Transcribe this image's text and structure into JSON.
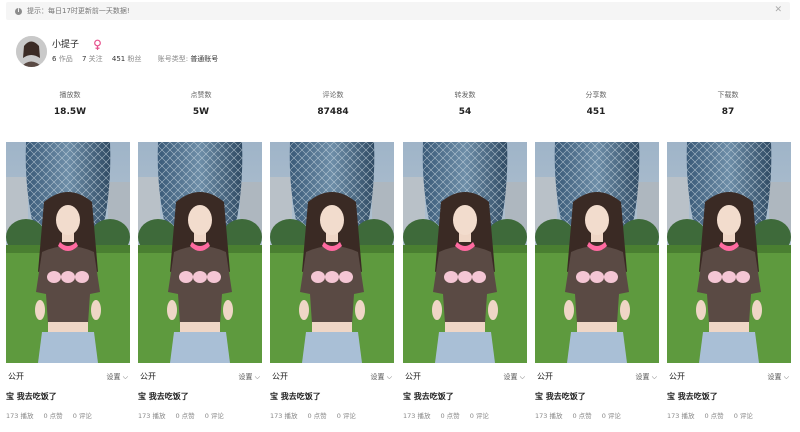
{
  "notice": {
    "text": "提示：每日17时更新前一天数据!"
  },
  "profile": {
    "name": "小提子",
    "works_count": "6",
    "works_label": "作品",
    "following_count": "7",
    "following_label": "关注",
    "followers_count": "451",
    "followers_label": "粉丝",
    "account_type_label": "账号类型:",
    "account_type_value": "普通账号"
  },
  "metrics": [
    {
      "label": "播放数",
      "value": "18.5W"
    },
    {
      "label": "点赞数",
      "value": "5W"
    },
    {
      "label": "评论数",
      "value": "87484"
    },
    {
      "label": "转发数",
      "value": "54"
    },
    {
      "label": "分享数",
      "value": "451"
    },
    {
      "label": "下载数",
      "value": "87"
    }
  ],
  "videos": [
    {
      "status": "公开",
      "settings": "设置",
      "title": "宝 我去吃饭了",
      "plays": "173 播放",
      "likes": "0 点赞",
      "comments": "0 评论"
    },
    {
      "status": "公开",
      "settings": "设置",
      "title": "宝 我去吃饭了",
      "plays": "173 播放",
      "likes": "0 点赞",
      "comments": "0 评论"
    },
    {
      "status": "公开",
      "settings": "设置",
      "title": "宝 我去吃饭了",
      "plays": "173 播放",
      "likes": "0 点赞",
      "comments": "0 评论"
    },
    {
      "status": "公开",
      "settings": "设置",
      "title": "宝 我去吃饭了",
      "plays": "173 播放",
      "likes": "0 点赞",
      "comments": "0 评论"
    },
    {
      "status": "公开",
      "settings": "设置",
      "title": "宝 我去吃饭了",
      "plays": "173 播放",
      "likes": "0 点赞",
      "comments": "0 评论"
    },
    {
      "status": "公开",
      "settings": "设置",
      "title": "宝 我去吃饭了",
      "plays": "173 播放",
      "likes": "0 点赞",
      "comments": "0 评论"
    }
  ],
  "colors": {
    "gender": "#e6508c",
    "notice_bg": "#f5f5f5",
    "shirt": "#5a4a44",
    "collar": "#ff6aa0"
  }
}
